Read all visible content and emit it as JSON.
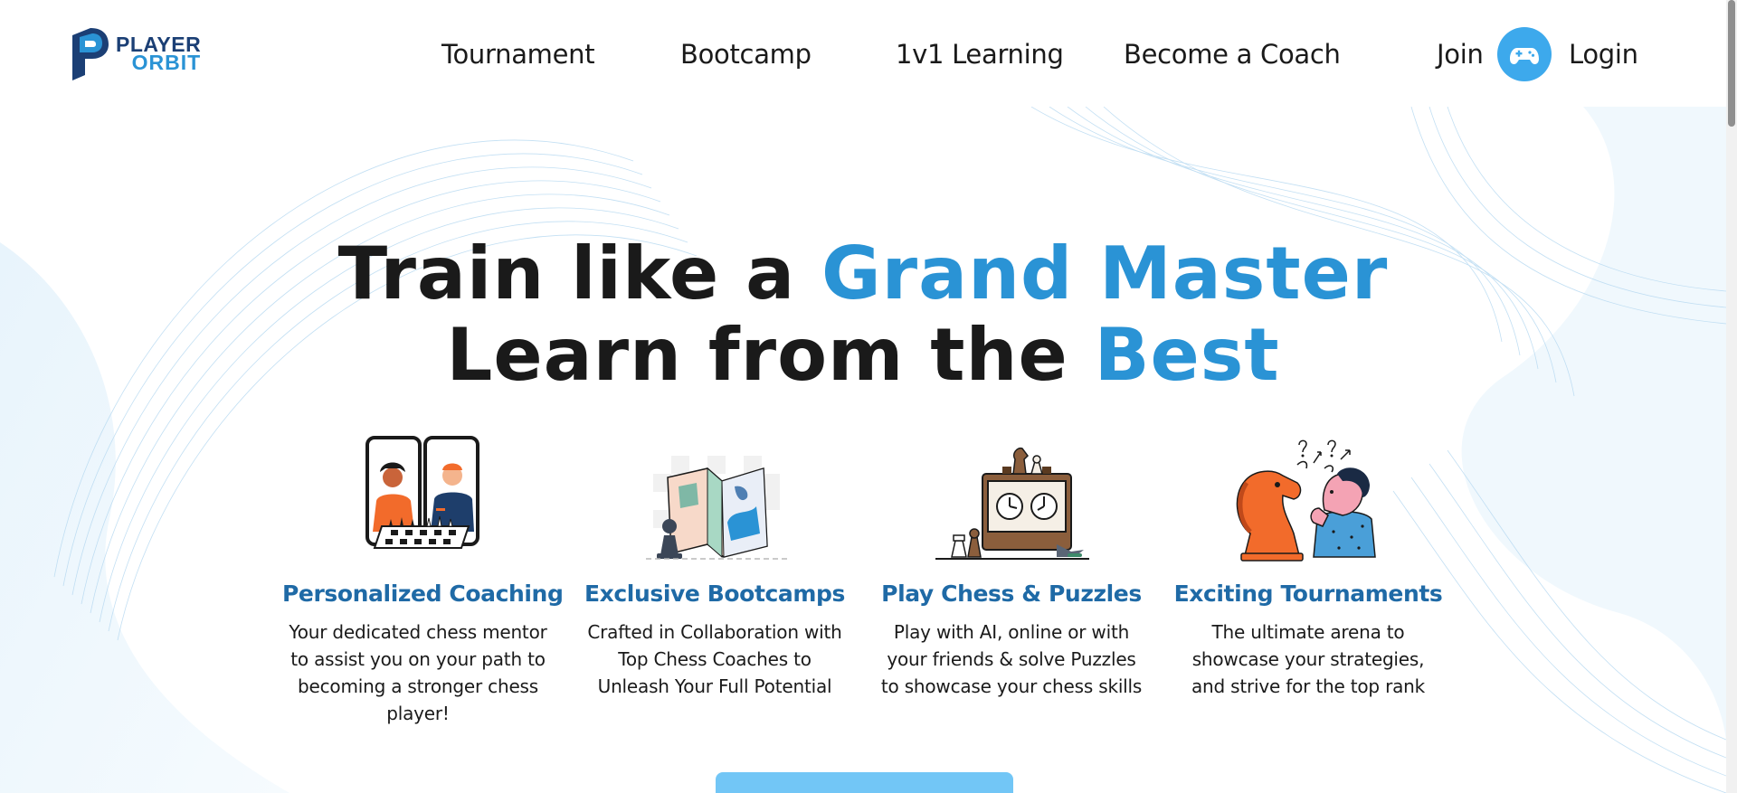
{
  "brand": {
    "name_line1": "PLAYER",
    "name_line2": "ORBIT",
    "colors": {
      "navy": "#1b3f75",
      "blue": "#2a93d5",
      "accent": "#3da9ec"
    }
  },
  "nav": {
    "items": [
      {
        "label": "Tournament"
      },
      {
        "label": "Bootcamp"
      },
      {
        "label": "1v1 Learning"
      },
      {
        "label": "Become a Coach"
      }
    ],
    "join_label": "Join",
    "game_icon": "gamepad-icon",
    "login_label": "Login"
  },
  "hero": {
    "line1_plain": "Train like a ",
    "line1_accent": "Grand Master",
    "line2_plain": "Learn from the ",
    "line2_accent": "Best"
  },
  "features": [
    {
      "title": "Personalized Coaching",
      "description": "Your dedicated chess mentor to assist you on your path to becoming a stronger chess player!"
    },
    {
      "title": "Exclusive Bootcamps",
      "description": "Crafted in Collaboration with Top Chess Coaches to Unleash Your Full Potential"
    },
    {
      "title": "Play Chess & Puzzles",
      "description": "Play with AI, online or with your friends & solve Puzzles to showcase your chess skills"
    },
    {
      "title": "Exciting Tournaments",
      "description": "The ultimate arena to showcase your strategies, and strive for the top rank"
    }
  ]
}
